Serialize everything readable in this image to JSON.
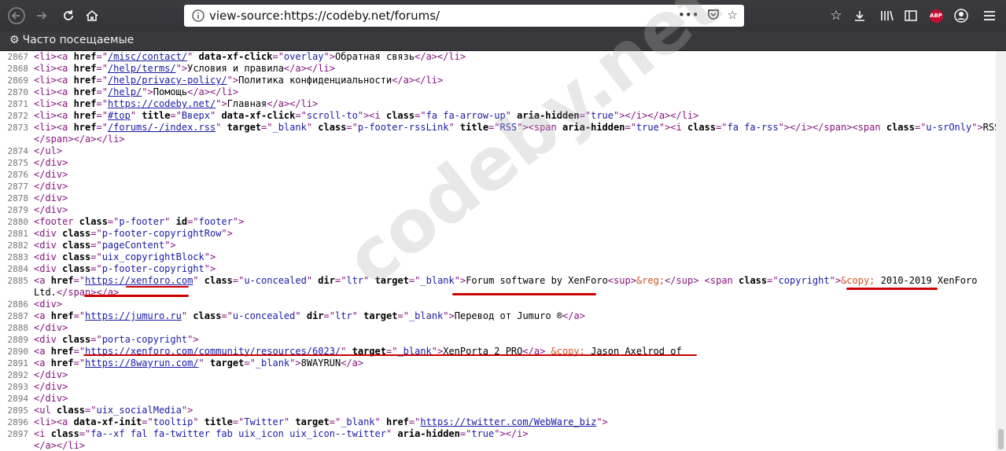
{
  "browser": {
    "url": "view-source:https://codeby.net/forums/",
    "bookmark_label": "Часто посещаемые",
    "abp_label": "ABP"
  },
  "watermark": "codeby.net",
  "lines": [
    {
      "n": "2867",
      "segs": [
        [
          "t",
          "<li><a "
        ],
        [
          "a",
          "href"
        ],
        [
          "t",
          "=\""
        ],
        [
          "l",
          "/misc/contact/"
        ],
        [
          "t",
          "\" "
        ],
        [
          "a",
          "data-xf-click"
        ],
        [
          "t",
          "=\""
        ],
        [
          "v",
          "overlay"
        ],
        [
          "t",
          "\">"
        ],
        [
          "x",
          "Обратная связь"
        ],
        [
          "t",
          "</a></li>"
        ]
      ]
    },
    {
      "n": "2868",
      "segs": [
        [
          "t",
          "<li><a "
        ],
        [
          "a",
          "href"
        ],
        [
          "t",
          "=\""
        ],
        [
          "l",
          "/help/terms/"
        ],
        [
          "t",
          "\">"
        ],
        [
          "x",
          "Условия и правила"
        ],
        [
          "t",
          "</a></li>"
        ]
      ]
    },
    {
      "n": "2869",
      "segs": [
        [
          "t",
          "<li><a "
        ],
        [
          "a",
          "href"
        ],
        [
          "t",
          "=\""
        ],
        [
          "l",
          "/help/privacy-policy/"
        ],
        [
          "t",
          "\">"
        ],
        [
          "x",
          "Политика конфиденциальности"
        ],
        [
          "t",
          "</a></li>"
        ]
      ]
    },
    {
      "n": "2870",
      "segs": [
        [
          "t",
          "<li><a "
        ],
        [
          "a",
          "href"
        ],
        [
          "t",
          "=\""
        ],
        [
          "l",
          "/help/"
        ],
        [
          "t",
          "\">"
        ],
        [
          "x",
          "Помощь"
        ],
        [
          "t",
          "</a></li>"
        ]
      ]
    },
    {
      "n": "2871",
      "segs": [
        [
          "t",
          "<li><a "
        ],
        [
          "a",
          "href"
        ],
        [
          "t",
          "=\""
        ],
        [
          "l",
          "https://codeby.net/"
        ],
        [
          "t",
          "\">"
        ],
        [
          "x",
          "Главная"
        ],
        [
          "t",
          "</a></li>"
        ]
      ]
    },
    {
      "n": "2872",
      "segs": [
        [
          "t",
          "<li><a "
        ],
        [
          "a",
          "href"
        ],
        [
          "t",
          "=\""
        ],
        [
          "l",
          "#top"
        ],
        [
          "t",
          "\" "
        ],
        [
          "a",
          "title"
        ],
        [
          "t",
          "=\""
        ],
        [
          "v",
          "Вверх"
        ],
        [
          "t",
          "\" "
        ],
        [
          "a",
          "data-xf-click"
        ],
        [
          "t",
          "=\""
        ],
        [
          "v",
          "scroll-to"
        ],
        [
          "t",
          "\"><i "
        ],
        [
          "a",
          "class"
        ],
        [
          "t",
          "=\""
        ],
        [
          "v",
          "fa fa-arrow-up"
        ],
        [
          "t",
          "\" "
        ],
        [
          "a",
          "aria-hidden"
        ],
        [
          "t",
          "=\""
        ],
        [
          "v",
          "true"
        ],
        [
          "t",
          "\"></i></a></li>"
        ]
      ]
    },
    {
      "n": "2873",
      "segs": [
        [
          "t",
          "<li><a "
        ],
        [
          "a",
          "href"
        ],
        [
          "t",
          "=\""
        ],
        [
          "l",
          "/forums/-/index.rss"
        ],
        [
          "t",
          "\" "
        ],
        [
          "a",
          "target"
        ],
        [
          "t",
          "=\""
        ],
        [
          "v",
          "_blank"
        ],
        [
          "t",
          "\" "
        ],
        [
          "a",
          "class"
        ],
        [
          "t",
          "=\""
        ],
        [
          "v",
          "p-footer-rssLink"
        ],
        [
          "t",
          "\" "
        ],
        [
          "a",
          "title"
        ],
        [
          "t",
          "=\""
        ],
        [
          "v",
          "RSS"
        ],
        [
          "t",
          "\"><span "
        ],
        [
          "a",
          "aria-hidden"
        ],
        [
          "t",
          "=\""
        ],
        [
          "v",
          "true"
        ],
        [
          "t",
          "\"><i "
        ],
        [
          "a",
          "class"
        ],
        [
          "t",
          "=\""
        ],
        [
          "v",
          "fa fa-rss"
        ],
        [
          "t",
          "\"></i></span><span "
        ],
        [
          "a",
          "class"
        ],
        [
          "t",
          "=\""
        ],
        [
          "v",
          "u-srOnly"
        ],
        [
          "t",
          "\">"
        ],
        [
          "x",
          "RSS"
        ],
        [
          "t",
          "</span>"
        ]
      ]
    },
    {
      "n": "",
      "segs": [
        [
          "t",
          "</span></a></li>"
        ]
      ]
    },
    {
      "n": "2874",
      "segs": [
        [
          "t",
          "</ul>"
        ]
      ]
    },
    {
      "n": "2875",
      "segs": [
        [
          "t",
          "</div>"
        ]
      ]
    },
    {
      "n": "2876",
      "segs": [
        [
          "t",
          "</div>"
        ]
      ]
    },
    {
      "n": "2877",
      "segs": [
        [
          "t",
          "</div>"
        ]
      ]
    },
    {
      "n": "2878",
      "segs": [
        [
          "t",
          "</div>"
        ]
      ]
    },
    {
      "n": "2879",
      "segs": [
        [
          "t",
          "</div>"
        ]
      ]
    },
    {
      "n": "2880",
      "segs": [
        [
          "t",
          "<footer "
        ],
        [
          "a",
          "class"
        ],
        [
          "t",
          "=\""
        ],
        [
          "v",
          "p-footer"
        ],
        [
          "t",
          "\" "
        ],
        [
          "a",
          "id"
        ],
        [
          "t",
          "=\""
        ],
        [
          "v",
          "footer"
        ],
        [
          "t",
          "\">"
        ]
      ]
    },
    {
      "n": "2881",
      "segs": [
        [
          "t",
          "<div "
        ],
        [
          "a",
          "class"
        ],
        [
          "t",
          "=\""
        ],
        [
          "v",
          "p-footer-copyrightRow"
        ],
        [
          "t",
          "\">"
        ]
      ]
    },
    {
      "n": "2882",
      "segs": [
        [
          "t",
          "<div "
        ],
        [
          "a",
          "class"
        ],
        [
          "t",
          "=\""
        ],
        [
          "v",
          "pageContent"
        ],
        [
          "t",
          "\">"
        ]
      ]
    },
    {
      "n": "2883",
      "segs": [
        [
          "t",
          "<div "
        ],
        [
          "a",
          "class"
        ],
        [
          "t",
          "=\""
        ],
        [
          "v",
          "uix_copyrightBlock"
        ],
        [
          "t",
          "\">"
        ]
      ]
    },
    {
      "n": "2884",
      "segs": [
        [
          "t",
          "<div "
        ],
        [
          "a",
          "class"
        ],
        [
          "t",
          "=\""
        ],
        [
          "v",
          "p-footer-copyright"
        ],
        [
          "t",
          "\">"
        ]
      ]
    },
    {
      "n": "2885",
      "segs": [
        [
          "t",
          "<a "
        ],
        [
          "a",
          "href"
        ],
        [
          "t",
          "=\""
        ],
        [
          "l",
          "https://xenforo.com"
        ],
        [
          "t",
          "\" "
        ],
        [
          "a",
          "class"
        ],
        [
          "t",
          "=\""
        ],
        [
          "v",
          "u-concealed"
        ],
        [
          "t",
          "\" "
        ],
        [
          "a",
          "dir"
        ],
        [
          "t",
          "=\""
        ],
        [
          "v",
          "ltr"
        ],
        [
          "t",
          "\" "
        ],
        [
          "a",
          "target"
        ],
        [
          "t",
          "=\""
        ],
        [
          "v",
          "_blank"
        ],
        [
          "t",
          "\">"
        ],
        [
          "x",
          "Forum software by XenForo"
        ],
        [
          "t",
          "<sup>"
        ],
        [
          "e",
          "&reg;"
        ],
        [
          "t",
          "</sup> <span "
        ],
        [
          "a",
          "class"
        ],
        [
          "t",
          "=\""
        ],
        [
          "v",
          "copyright"
        ],
        [
          "t",
          "\">"
        ],
        [
          "e",
          "&copy;"
        ],
        [
          "x",
          " 2010-2019 XenForo"
        ]
      ]
    },
    {
      "n": "",
      "segs": [
        [
          "x",
          "Ltd."
        ],
        [
          "t",
          "</span></a>"
        ]
      ]
    },
    {
      "n": "2886",
      "segs": [
        [
          "t",
          "<div>"
        ]
      ]
    },
    {
      "n": "2887",
      "segs": [
        [
          "t",
          "<a "
        ],
        [
          "a",
          "href"
        ],
        [
          "t",
          "=\""
        ],
        [
          "l",
          "https://jumuro.ru"
        ],
        [
          "t",
          "\" "
        ],
        [
          "a",
          "class"
        ],
        [
          "t",
          "=\""
        ],
        [
          "v",
          "u-concealed"
        ],
        [
          "t",
          "\" "
        ],
        [
          "a",
          "dir"
        ],
        [
          "t",
          "=\""
        ],
        [
          "v",
          "ltr"
        ],
        [
          "t",
          "\" "
        ],
        [
          "a",
          "target"
        ],
        [
          "t",
          "=\""
        ],
        [
          "v",
          "_blank"
        ],
        [
          "t",
          "\">"
        ],
        [
          "x",
          "Перевод от Jumuro ®"
        ],
        [
          "t",
          "</a>"
        ]
      ]
    },
    {
      "n": "2888",
      "segs": [
        [
          "t",
          "</div>"
        ]
      ]
    },
    {
      "n": "2889",
      "segs": [
        [
          "t",
          "<div "
        ],
        [
          "a",
          "class"
        ],
        [
          "t",
          "=\""
        ],
        [
          "v",
          "porta-copyright"
        ],
        [
          "t",
          "\">"
        ]
      ]
    },
    {
      "n": "2890",
      "segs": [
        [
          "t",
          "<a "
        ],
        [
          "a",
          "href"
        ],
        [
          "t",
          "=\""
        ],
        [
          "l",
          "https://xenforo.com/community/resources/6023/"
        ],
        [
          "t",
          "\" "
        ],
        [
          "a",
          "target"
        ],
        [
          "t",
          "=\""
        ],
        [
          "v",
          "_blank"
        ],
        [
          "t",
          "\">"
        ],
        [
          "x",
          "XenPorta 2 PRO"
        ],
        [
          "t",
          "</a> "
        ],
        [
          "e",
          "&copy;"
        ],
        [
          "x",
          " Jason Axelrod of"
        ]
      ]
    },
    {
      "n": "2891",
      "segs": [
        [
          "t",
          "<a "
        ],
        [
          "a",
          "href"
        ],
        [
          "t",
          "=\""
        ],
        [
          "l",
          "https://8wayrun.com/"
        ],
        [
          "t",
          "\" "
        ],
        [
          "a",
          "target"
        ],
        [
          "t",
          "=\""
        ],
        [
          "v",
          "_blank"
        ],
        [
          "t",
          "\">"
        ],
        [
          "x",
          "8WAYRUN"
        ],
        [
          "t",
          "</a>"
        ]
      ]
    },
    {
      "n": "2892",
      "segs": [
        [
          "t",
          "</div>"
        ]
      ]
    },
    {
      "n": "2893",
      "segs": [
        [
          "t",
          "</div>"
        ]
      ]
    },
    {
      "n": "2894",
      "segs": [
        [
          "t",
          "</div>"
        ]
      ]
    },
    {
      "n": "2895",
      "segs": [
        [
          "t",
          "<ul "
        ],
        [
          "a",
          "class"
        ],
        [
          "t",
          "=\""
        ],
        [
          "v",
          "uix_socialMedia"
        ],
        [
          "t",
          "\">"
        ]
      ]
    },
    {
      "n": "2896",
      "segs": [
        [
          "t",
          "<li><a "
        ],
        [
          "a",
          "data-xf-init"
        ],
        [
          "t",
          "=\""
        ],
        [
          "v",
          "tooltip"
        ],
        [
          "t",
          "\" "
        ],
        [
          "a",
          "title"
        ],
        [
          "t",
          "=\""
        ],
        [
          "v",
          "Twitter"
        ],
        [
          "t",
          "\" "
        ],
        [
          "a",
          "target"
        ],
        [
          "t",
          "=\""
        ],
        [
          "v",
          "_blank"
        ],
        [
          "t",
          "\" "
        ],
        [
          "a",
          "href"
        ],
        [
          "t",
          "=\""
        ],
        [
          "l",
          "https://twitter.com/WebWare_biz"
        ],
        [
          "t",
          "\">"
        ]
      ]
    },
    {
      "n": "2897",
      "segs": [
        [
          "t",
          "<i "
        ],
        [
          "a",
          "class"
        ],
        [
          "t",
          "=\""
        ],
        [
          "v",
          "fa--xf fal fa-twitter fab uix_icon uix_icon--twitter"
        ],
        [
          "t",
          "\" "
        ],
        [
          "a",
          "aria-hidden"
        ],
        [
          "t",
          "=\""
        ],
        [
          "v",
          "true"
        ],
        [
          "t",
          "\"></i>"
        ]
      ]
    },
    {
      "n": "",
      "segs": [
        [
          "t",
          "</a></li>"
        ]
      ]
    }
  ]
}
